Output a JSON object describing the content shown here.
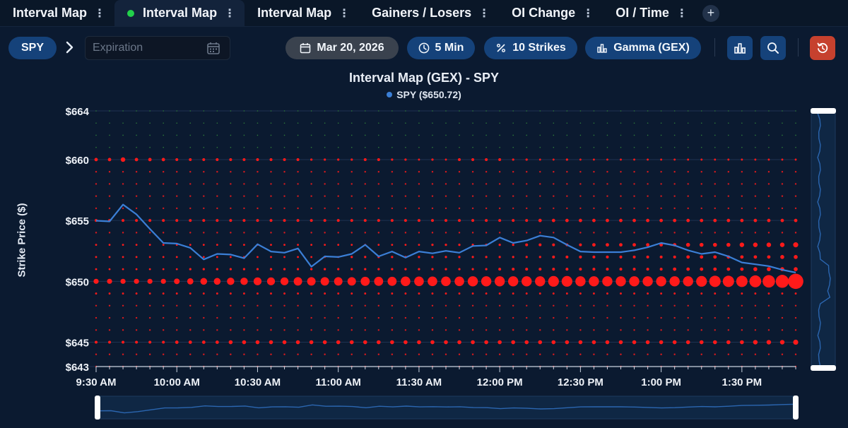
{
  "tabs": [
    {
      "label": "Interval Map",
      "active": false,
      "live": false
    },
    {
      "label": "Interval Map",
      "active": true,
      "live": true
    },
    {
      "label": "Interval Map",
      "active": false,
      "live": false
    },
    {
      "label": "Gainers / Losers",
      "active": false,
      "live": false
    },
    {
      "label": "OI Change",
      "active": false,
      "live": false
    },
    {
      "label": "OI / Time",
      "active": false,
      "live": false
    }
  ],
  "tab_more_glyph": "⋮",
  "tab_add_glyph": "+",
  "toolbar": {
    "symbol": "SPY",
    "expiration_placeholder": "Expiration",
    "date": "Mar 20, 2026",
    "interval": "5 Min",
    "strikes": "10 Strikes",
    "metric": "Gamma (GEX)",
    "icons": [
      "chevron-right-icon",
      "calendar-icon",
      "clock-icon",
      "percent-icon",
      "bar-chart-icon",
      "search-icon",
      "reset-icon"
    ]
  },
  "colors": {
    "bubble": "#ff1a1a",
    "price_line": "#3b7fd6",
    "pill": "#15427a",
    "reset": "#c6412e"
  },
  "chart_data": {
    "type": "bubble-scatter",
    "title": "Interval Map (GEX) - SPY",
    "legend": "SPY ($650.72)",
    "ylabel": "Strike Price ($)",
    "ylim": [
      643,
      664
    ],
    "yticks": [
      664,
      660,
      655,
      650,
      645,
      643
    ],
    "ytick_labels": [
      "$664",
      "$660",
      "$655",
      "$650",
      "$645",
      "$643"
    ],
    "x_start": "9:30 AM",
    "x_end": "1:45 PM",
    "interval_minutes": 5,
    "xtick_labels": [
      "9:30 AM",
      "10:00 AM",
      "10:30 AM",
      "11:00 AM",
      "11:30 AM",
      "12:00 PM",
      "12:30 PM",
      "1:00 PM",
      "1:30 PM"
    ],
    "strikes": [
      643,
      644,
      645,
      646,
      647,
      648,
      649,
      650,
      651,
      652,
      653,
      654,
      655,
      656,
      657,
      658,
      659,
      660,
      661,
      662,
      663,
      664
    ],
    "bubble_scale": {
      "min": 1,
      "max": 25
    },
    "rows": {
      "660": [
        4,
        4,
        6,
        4,
        4,
        4,
        3,
        3,
        3,
        3,
        3,
        3,
        3,
        3,
        3,
        3,
        2,
        2,
        2,
        2,
        3,
        3,
        2,
        2,
        1,
        2,
        1,
        3,
        3,
        3,
        3,
        2,
        2,
        1,
        1,
        2,
        1,
        1,
        1,
        1,
        1,
        1,
        1,
        1,
        1,
        1,
        1,
        1,
        1,
        1,
        1,
        1,
        1
      ],
      "655": [
        3,
        3,
        3,
        3,
        3,
        3,
        3,
        3,
        3,
        3,
        3,
        3,
        3,
        3,
        3,
        3,
        3,
        3,
        3,
        3,
        3,
        3,
        3,
        3,
        3,
        3,
        3,
        3,
        3,
        3,
        3,
        3,
        3,
        4,
        4,
        4,
        4,
        4,
        4,
        4,
        4,
        4,
        4,
        4,
        4,
        4,
        4,
        4,
        4,
        4,
        4,
        4,
        4
      ],
      "653": [
        1,
        1,
        1,
        1,
        1,
        1,
        1,
        1,
        1,
        1,
        1,
        1,
        1,
        1,
        1,
        1,
        1,
        1,
        1,
        1,
        1,
        1,
        1,
        1,
        1,
        2,
        2,
        2,
        2,
        2,
        2,
        2,
        3,
        3,
        3,
        3,
        3,
        4,
        4,
        4,
        4,
        4,
        4,
        4,
        5,
        5,
        5,
        5,
        6,
        6,
        6,
        6,
        7
      ],
      "652": [
        1,
        1,
        1,
        1,
        1,
        1,
        1,
        1,
        1,
        1,
        1,
        1,
        1,
        1,
        1,
        1,
        1,
        1,
        1,
        2,
        2,
        2,
        2,
        2,
        2,
        2,
        2,
        2,
        2,
        2,
        2,
        2,
        2,
        2,
        3,
        3,
        3,
        3,
        3,
        3,
        3,
        3,
        3,
        3,
        4,
        4,
        4,
        4,
        4,
        4,
        4,
        5,
        5
      ],
      "651": [
        1,
        1,
        1,
        1,
        1,
        1,
        1,
        2,
        2,
        2,
        2,
        2,
        2,
        2,
        2,
        2,
        2,
        2,
        2,
        2,
        2,
        2,
        2,
        2,
        2,
        2,
        2,
        2,
        2,
        2,
        3,
        3,
        3,
        3,
        3,
        3,
        3,
        3,
        3,
        3,
        3,
        3,
        3,
        4,
        4,
        4,
        4,
        4,
        4,
        5,
        5,
        5,
        5
      ],
      "650": [
        7,
        7,
        7,
        7,
        7,
        7,
        8,
        9,
        10,
        10,
        11,
        11,
        12,
        12,
        12,
        13,
        13,
        13,
        13,
        13,
        14,
        14,
        14,
        15,
        15,
        15,
        15,
        15,
        16,
        16,
        16,
        16,
        16,
        16,
        17,
        17,
        16,
        16,
        16,
        16,
        16,
        16,
        16,
        16,
        16,
        17,
        18,
        18,
        18,
        19,
        20,
        21,
        25
      ],
      "649": [
        1,
        1,
        1,
        1,
        1,
        1,
        1,
        1,
        1,
        1,
        1,
        1,
        1,
        1,
        1,
        1,
        1,
        1,
        1,
        1,
        1,
        1,
        1,
        1,
        1,
        1,
        1,
        1,
        1,
        1,
        1,
        1,
        1,
        1,
        1,
        1,
        1,
        1,
        1,
        1,
        1,
        1,
        1,
        1,
        1,
        1,
        1,
        1,
        1,
        1,
        1,
        1,
        1
      ],
      "645": [
        3,
        3,
        3,
        3,
        3,
        3,
        4,
        4,
        4,
        4,
        5,
        5,
        5,
        5,
        5,
        5,
        5,
        5,
        5,
        5,
        5,
        5,
        5,
        5,
        5,
        5,
        5,
        5,
        5,
        5,
        5,
        5,
        5,
        5,
        5,
        5,
        5,
        5,
        5,
        5,
        5,
        5,
        5,
        5,
        5,
        5,
        5,
        5,
        5,
        6,
        6,
        6,
        7
      ]
    },
    "series": [
      {
        "name": "SPY",
        "values": [
          654.98,
          654.92,
          656.3,
          655.5,
          654.3,
          653.15,
          653.1,
          652.75,
          651.8,
          652.25,
          652.2,
          651.9,
          653.05,
          652.45,
          652.35,
          652.7,
          651.2,
          652.05,
          652.0,
          652.25,
          653.0,
          652.05,
          652.45,
          651.95,
          652.45,
          652.3,
          652.5,
          652.35,
          652.9,
          652.95,
          653.6,
          653.15,
          653.35,
          653.75,
          653.6,
          653.0,
          652.45,
          652.4,
          652.4,
          652.4,
          652.55,
          652.8,
          653.15,
          652.95,
          652.55,
          652.25,
          652.4,
          652.05,
          651.55,
          651.4,
          651.25,
          650.95,
          650.72
        ]
      }
    ]
  }
}
